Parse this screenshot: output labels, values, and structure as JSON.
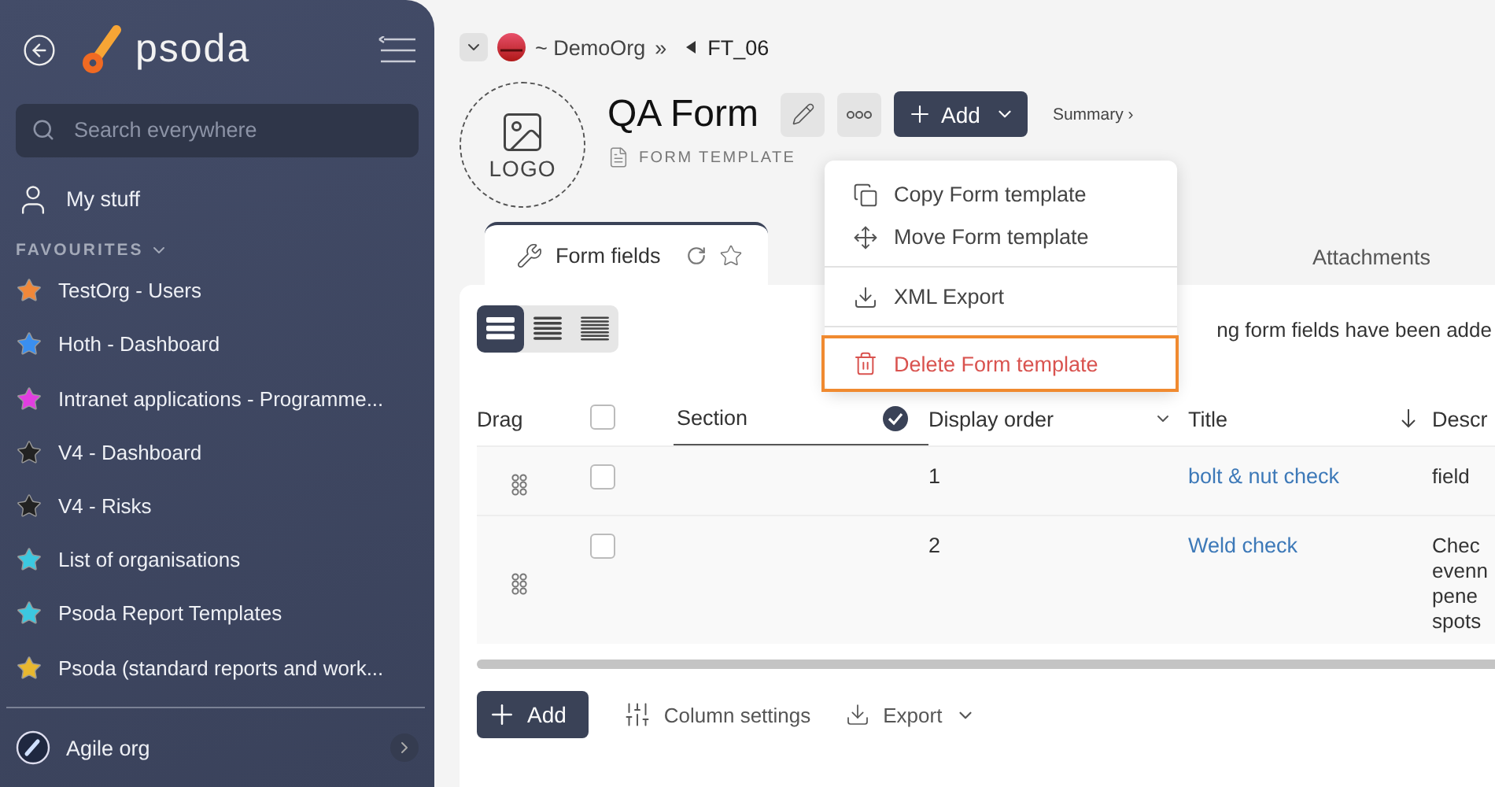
{
  "sidebar": {
    "brand": "psoda",
    "search": {
      "placeholder": "Search everywhere"
    },
    "my_stuff": "My stuff",
    "favourites_heading": "FAVOURITES",
    "favourites": [
      {
        "label": "TestOrg - Users",
        "color": "#f0883a"
      },
      {
        "label": "Hoth - Dashboard",
        "color": "#3a8ff0"
      },
      {
        "label": "Intranet applications - Programme...",
        "color": "#e23ee0"
      },
      {
        "label": "V4 - Dashboard",
        "color": "#222222"
      },
      {
        "label": "V4 - Risks",
        "color": "#222222"
      },
      {
        "label": "List of organisations",
        "color": "#3cc8e0"
      },
      {
        "label": "Psoda Report Templates",
        "color": "#3cc8e0"
      },
      {
        "label": "Psoda (standard reports and work...",
        "color": "#e8b830"
      }
    ],
    "organisation": "Agile org"
  },
  "breadcrumb": {
    "organisation": "~ DemoOrg",
    "separator": "»",
    "current": "FT_06"
  },
  "header": {
    "logo_placeholder": "LOGO",
    "title": "QA Form",
    "subtitle": "FORM TEMPLATE",
    "add_button": "Add",
    "summary_link": "Summary ›"
  },
  "context_menu": {
    "items": [
      {
        "kind": "copy",
        "label": "Copy Form template",
        "highlighted": false
      },
      {
        "kind": "move",
        "label": "Move Form template",
        "highlighted": false
      },
      {
        "kind": "export",
        "label": "XML Export",
        "highlighted": false
      },
      {
        "kind": "delete",
        "label": "Delete Form template",
        "highlighted": true
      }
    ]
  },
  "tabs": [
    {
      "label": "Form fields",
      "selected": true
    },
    {
      "label": "Attachments",
      "selected": false
    }
  ],
  "view_modes": [
    {
      "selected": true
    },
    {
      "selected": false
    },
    {
      "selected": false
    }
  ],
  "notice": "ng form fields have been adde",
  "table": {
    "select_all": {
      "checked": false
    },
    "columns": [
      "Drag",
      "Section",
      "Display order",
      "Title",
      "Descr"
    ],
    "rows": [
      {
        "checked": false,
        "display_order": "1",
        "title": "bolt & nut check",
        "description": [
          "field"
        ]
      },
      {
        "checked": false,
        "display_order": "2",
        "title": "Weld check",
        "description": [
          "Chec",
          "evenn",
          "pene",
          "spots"
        ]
      }
    ]
  },
  "footer": {
    "add_button": "Add",
    "column_settings": "Column settings",
    "export": "Export"
  }
}
